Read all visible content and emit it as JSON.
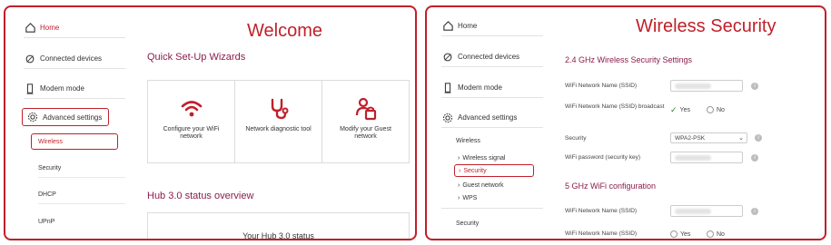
{
  "left": {
    "title": "Welcome",
    "nav": [
      {
        "label": "Home",
        "icon": "home-icon"
      },
      {
        "label": "Connected devices",
        "icon": "devices-icon"
      },
      {
        "label": "Modem mode",
        "icon": "modem-icon"
      },
      {
        "label": "Advanced settings",
        "icon": "gear-icon"
      }
    ],
    "sub": [
      {
        "label": "Wireless"
      },
      {
        "label": "Security"
      },
      {
        "label": "DHCP"
      },
      {
        "label": "UPnP"
      }
    ],
    "wizards_title": "Quick Set-Up Wizards",
    "wizards": [
      {
        "label": "Configure your WiFi network",
        "icon": "wifi-icon"
      },
      {
        "label": "Network diagnostic tool",
        "icon": "stethoscope-icon"
      },
      {
        "label": "Modify your Guest network",
        "icon": "guest-network-icon"
      }
    ],
    "status_title": "Hub 3.0 status overview",
    "status_text": "Your Hub 3.0 status"
  },
  "right": {
    "title": "Wireless Security",
    "nav": [
      {
        "label": "Home",
        "icon": "home-icon"
      },
      {
        "label": "Connected devices",
        "icon": "devices-icon"
      },
      {
        "label": "Modem mode",
        "icon": "modem-icon"
      },
      {
        "label": "Advanced settings",
        "icon": "gear-icon"
      }
    ],
    "sub_heading": "Wireless",
    "sub": [
      {
        "label": "Wireless signal"
      },
      {
        "label": "Security"
      },
      {
        "label": "Guest network"
      },
      {
        "label": "WPS"
      }
    ],
    "security_label": "Security",
    "section24": "2.4 GHz Wireless Security Settings",
    "ssid_label": "WiFi Network Name (SSID)",
    "broadcast_label": "WiFi Network Name (SSID) broadcast",
    "yes_label": "Yes",
    "no_label": "No",
    "security_field_label": "Security",
    "security_value": "WPA2-PSK",
    "password_label": "WiFi password (security key)",
    "section5": "5 GHz WiFi configuration",
    "ssid5_label": "WiFi Network Name (SSID)",
    "broadcast5_label": "WiFi Network Name (SSID)",
    "yes5_label": "Yes",
    "no5_label": "No"
  },
  "colors": {
    "accent": "#c0202a",
    "section": "#8b1d4a"
  }
}
